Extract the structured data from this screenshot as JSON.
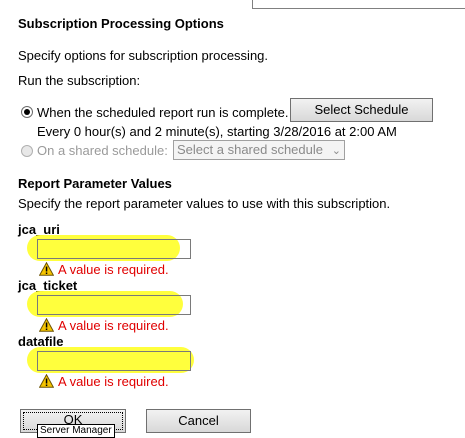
{
  "section_title": "Subscription Processing Options",
  "intro": "Specify options for subscription processing.",
  "run_label": "Run the subscription:",
  "option_scheduled": {
    "label": "When the scheduled report run is complete.",
    "selected": true,
    "button": "Select Schedule",
    "schedule_text": "Every 0 hour(s) and 2 minute(s), starting 3/28/2016 at 2:00 AM"
  },
  "option_shared": {
    "label": "On a shared schedule:",
    "selected": false,
    "select_value": "Select a shared schedule"
  },
  "params": {
    "title": "Report Parameter Values",
    "description": "Specify the report parameter values to use with this subscription.",
    "items": [
      {
        "name": "jca_uri",
        "value": "",
        "error": "A value is required."
      },
      {
        "name": "jca_ticket",
        "value": "",
        "error": "A value is required."
      },
      {
        "name": "datafile",
        "value": "",
        "error": "A value is required."
      }
    ]
  },
  "buttons": {
    "ok": "OK",
    "cancel": "Cancel"
  },
  "tooltip": "Server Manager",
  "colors": {
    "highlight": "#ffff33",
    "error": "#e00000"
  },
  "icons": {
    "warning": "warning-icon"
  }
}
